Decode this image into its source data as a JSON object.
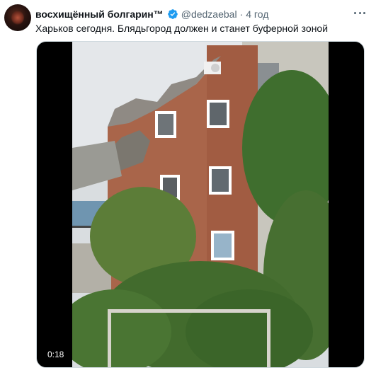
{
  "author": {
    "display_name": "восхищённый болгарин™",
    "handle": "@dedzaebal",
    "timestamp": "4 год",
    "separator": "·"
  },
  "tweet": {
    "text": "Харьков сегодня. Блядьгород должен и станет буферной зоной"
  },
  "media": {
    "type": "video",
    "duration": "0:18"
  },
  "icons": {
    "verified": "verified-badge-icon",
    "more": "more-options-icon"
  },
  "colors": {
    "text_primary": "#0f1419",
    "text_secondary": "#536471",
    "verified_blue": "#1d9bf0",
    "media_background": "#000000"
  }
}
